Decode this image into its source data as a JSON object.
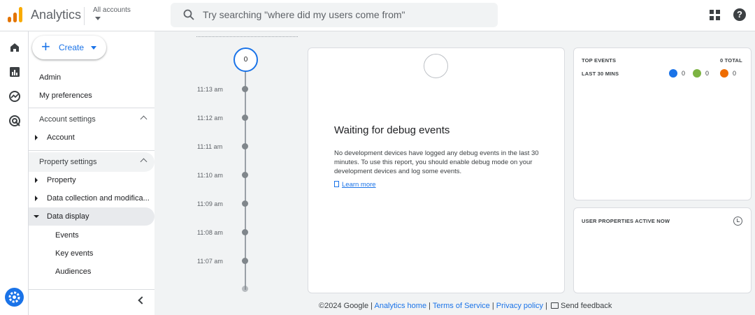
{
  "header": {
    "app_title": "Analytics",
    "account_selector": "All accounts",
    "search_placeholder": "Try searching \"where did my users come from\""
  },
  "colors": {
    "accent": "#1a73e8",
    "logo_bars": [
      "#f9ab00",
      "#e37400",
      "#e37400"
    ],
    "badge_user": "#1a73e8",
    "badge_conversion": "#7cb342",
    "badge_error": "#ef6c00"
  },
  "rail": {
    "icons": [
      "home-icon",
      "reports-icon",
      "explore-icon",
      "advertising-icon",
      "admin-gear-icon"
    ]
  },
  "nav": {
    "create_label": "Create",
    "admin": "Admin",
    "my_preferences": "My preferences",
    "account_settings": "Account settings",
    "account": "Account",
    "property_settings": "Property settings",
    "property": "Property",
    "data_collection": "Data collection and modifica...",
    "data_display": "Data display",
    "events": "Events",
    "key_events": "Key events",
    "audiences": "Audiences"
  },
  "timeline": {
    "count": "0",
    "times": [
      "11:13 am",
      "11:12 am",
      "11:11 am",
      "11:10 am",
      "11:09 am",
      "11:08 am",
      "11:07 am"
    ]
  },
  "debug": {
    "title": "Waiting for debug events",
    "body": "No development devices have logged any debug events in the last 30 minutes. To use this report, you should enable debug mode on your development devices and log some events.",
    "learn_more": "Learn more"
  },
  "top_events": {
    "title": "TOP EVENTS",
    "total": "0 TOTAL",
    "period": "LAST 30 MINS",
    "counts": [
      "0",
      "0",
      "0"
    ]
  },
  "user_properties": {
    "title": "USER PROPERTIES ACTIVE NOW"
  },
  "footer": {
    "copyright": "©2024 Google",
    "analytics_home": "Analytics home",
    "terms": "Terms of Service",
    "privacy": "Privacy policy",
    "separator": "|",
    "send_feedback": "Send feedback"
  }
}
